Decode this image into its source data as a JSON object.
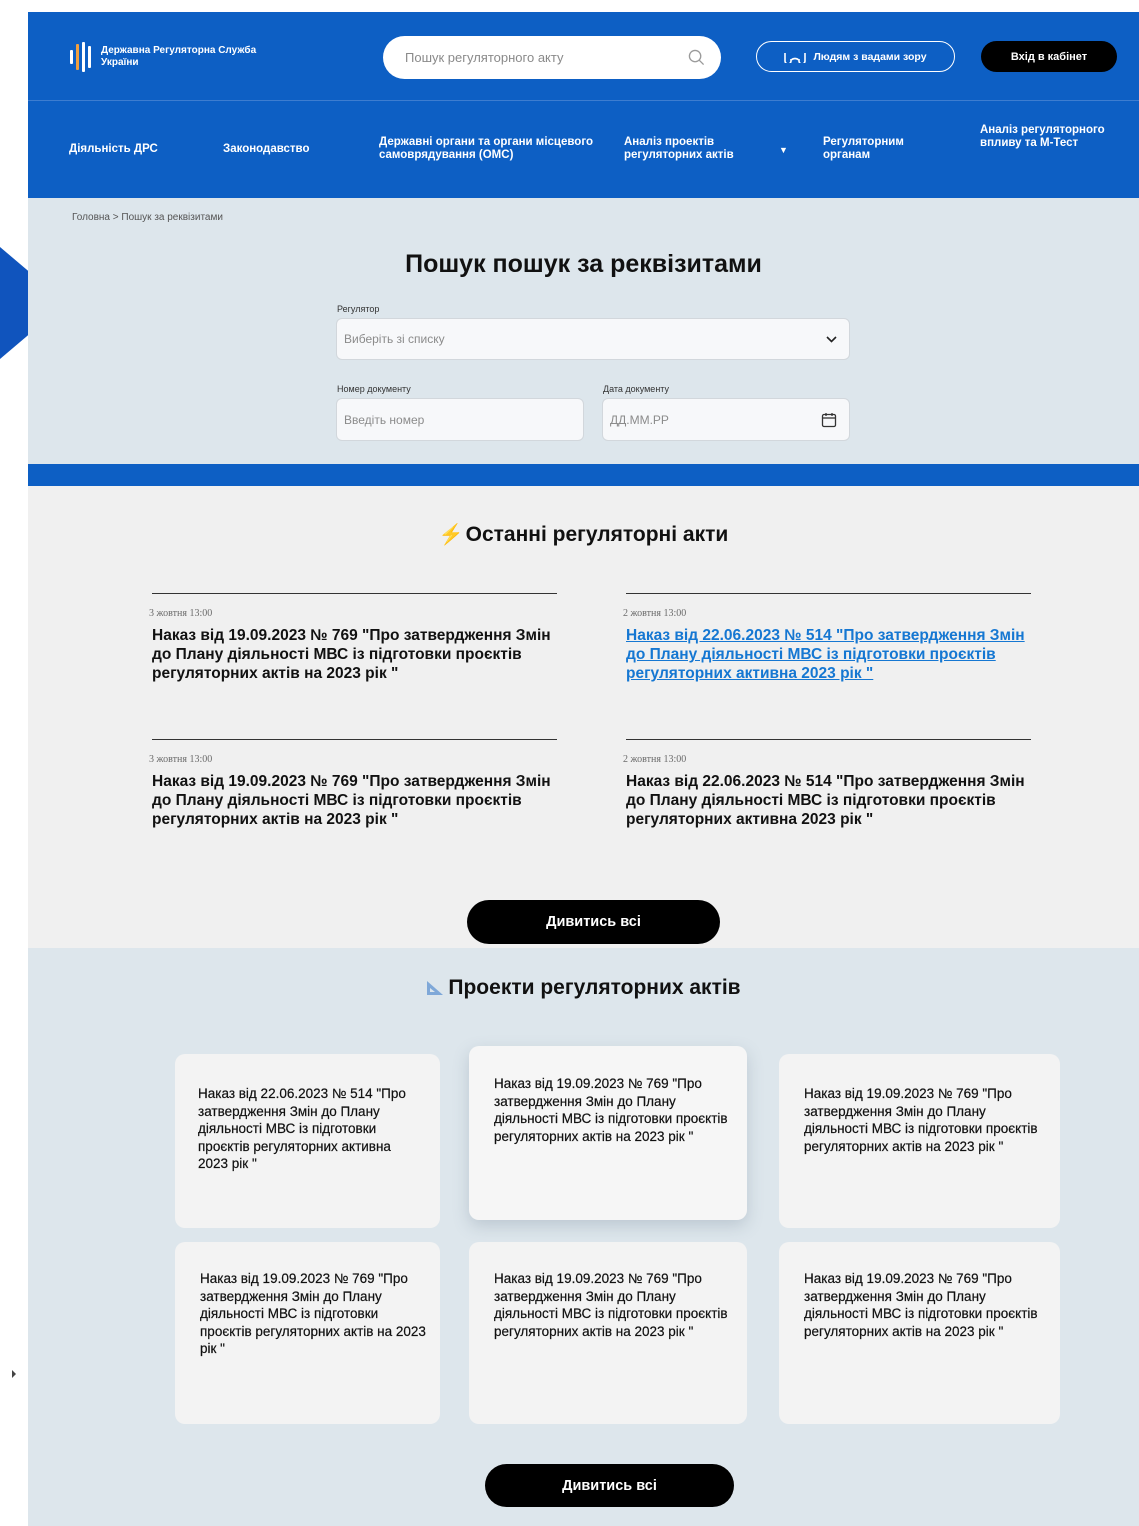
{
  "colors": {
    "brand_blue": "#0d5fc4",
    "link_blue": "#1577d2",
    "button_black": "#000000",
    "section_gray": "#dde6ec",
    "page_gray": "#f0f0f0"
  },
  "header": {
    "logo_text": "Державна Регуляторна Служба України",
    "search_placeholder": "Пошук регуляторного акту",
    "vision_label": "Людям з вадами зору",
    "login_label": "Вхід в кабінет",
    "icons": {
      "search": "search-icon",
      "vision": "glasses-icon",
      "logo": "trident-logo-icon"
    }
  },
  "nav": [
    {
      "label": "Діяльність ДРС"
    },
    {
      "label": "Законодавство"
    },
    {
      "label": "Державні органи та органи місцевого самоврядування (ОМС)"
    },
    {
      "label": "Аналіз проектів регуляторних актів"
    },
    {
      "label": "Регуляторним органам"
    },
    {
      "label": "Аналіз регуляторного впливу та М-Тест"
    }
  ],
  "breadcrumb": "Головна > Пошук за реквізитами",
  "search_page": {
    "title": "Пошук пошук за реквізитами",
    "regulator_label": "Регулятор",
    "regulator_value": "Виберіть зі списку",
    "doc_number_label": "Номер документу",
    "doc_number_placeholder": "Введіть номер",
    "doc_date_label": "Дата документу",
    "doc_date_placeholder": "ДД.ММ.РР"
  },
  "latest": {
    "title": "Останні регуляторні акти",
    "items": [
      {
        "date": "3 жовтня  13:00",
        "title": "Наказ від 19.09.2023 № 769 \"Про затвердження Змін до Плану діяльності МВС із підготовки проєктів регуляторних актів на 2023 рік \""
      },
      {
        "date": "2 жовтня  13:00",
        "title": "Наказ від 22.06.2023 № 514 \"Про затвердження Змін до Плану діяльності МВС із підготовки проєктів регуляторних активна 2023 рік \""
      },
      {
        "date": "3 жовтня  13:00",
        "title": "Наказ від 19.09.2023 № 769 \"Про затвердження Змін до Плану діяльності МВС із підготовки проєктів регуляторних актів на 2023 рік \""
      },
      {
        "date": "2 жовтня  13:00",
        "title": "Наказ від 22.06.2023 № 514 \"Про затвердження Змін до Плану діяльності МВС із підготовки проєктів регуляторних активна 2023 рік \""
      }
    ],
    "see_all": "Дивитись всі"
  },
  "projects": {
    "title": "Проекти регуляторних актів",
    "cards": [
      {
        "text": "Наказ від 22.06.2023 № 514 \"Про затвердження Змін до Плану діяльності МВС із підготовки проєктів регуляторних активна 2023 рік \""
      },
      {
        "text": "Наказ від 19.09.2023 № 769 \"Про затвердження Змін до Плану діяльності МВС із підготовки проєктів регуляторних актів на 2023 рік \""
      },
      {
        "text": "Наказ від 19.09.2023 № 769 \"Про затвердження Змін до Плану діяльності МВС із підготовки проєктів регуляторних актів на 2023 рік \""
      },
      {
        "text": "Наказ від 19.09.2023 № 769 \"Про затвердження Змін до Плану діяльності МВС із підготовки проєктів регуляторних актів на 2023 рік \""
      },
      {
        "text": "Наказ від 19.09.2023 № 769 \"Про затвердження Змін до Плану діяльності МВС із підготовки проєктів регуляторних актів на 2023 рік \""
      },
      {
        "text": "Наказ від 19.09.2023 № 769 \"Про затвердження Змін до Плану діяльності МВС із підготовки проєктів регуляторних актів на 2023 рік \""
      }
    ],
    "see_all": "Дивитись всі"
  }
}
